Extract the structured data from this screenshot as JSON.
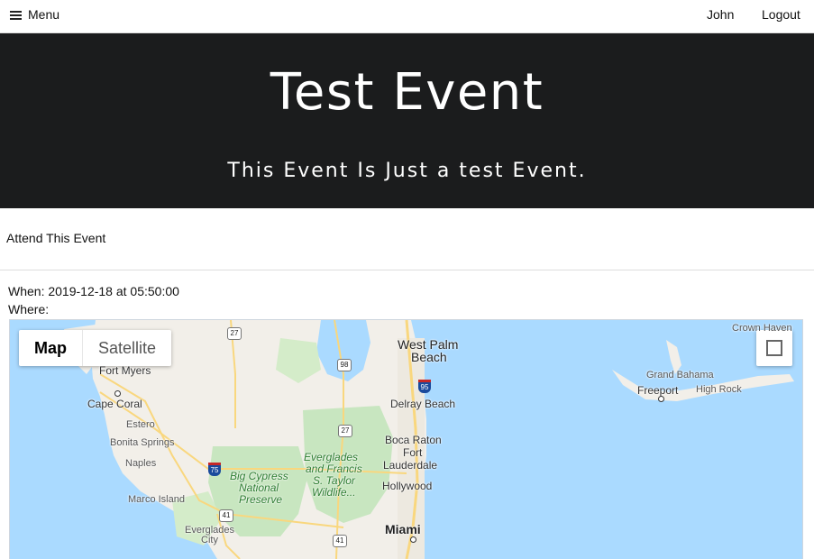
{
  "nav": {
    "menu_label": "Menu",
    "user_name": "John",
    "logout_label": "Logout"
  },
  "hero": {
    "title": "Test Event",
    "subtitle": "This Event Is Just a test Event."
  },
  "actions": {
    "attend_label": "Attend This Event"
  },
  "details": {
    "when": "When: 2019-12-18 at 05:50:00",
    "where_label": "Where:"
  },
  "map": {
    "type_map": "Map",
    "type_satellite": "Satellite",
    "places": {
      "west_palm": "West Palm",
      "beach": "Beach",
      "delray": "Delray Beach",
      "boca": "Boca Raton",
      "fort": "Fort",
      "lauderdale": "Lauderdale",
      "hollywood": "Hollywood",
      "miami": "Miami",
      "fort_myers": "Fort Myers",
      "cape_coral": "Cape Coral",
      "estero": "Estero",
      "bonita": "Bonita Springs",
      "naples": "Naples",
      "marco": "Marco Island",
      "everglades_city_1": "Everglades",
      "everglades_city_2": "City",
      "grand_bahama": "Grand Bahama",
      "freeport": "Freeport",
      "high_rock": "High Rock",
      "crown_haven": "Crown Haven"
    },
    "parks": {
      "everglades_1": "Everglades",
      "everglades_2": "and Francis",
      "everglades_3": "S. Taylor",
      "everglades_4": "Wildlife...",
      "big_cypress_1": "Big Cypress",
      "big_cypress_2": "National",
      "big_cypress_3": "Preserve"
    },
    "shields": {
      "us27_a": "27",
      "us98": "98",
      "i95": "95",
      "us27_b": "27",
      "i75": "75",
      "us41_a": "41",
      "us41_b": "41"
    }
  }
}
